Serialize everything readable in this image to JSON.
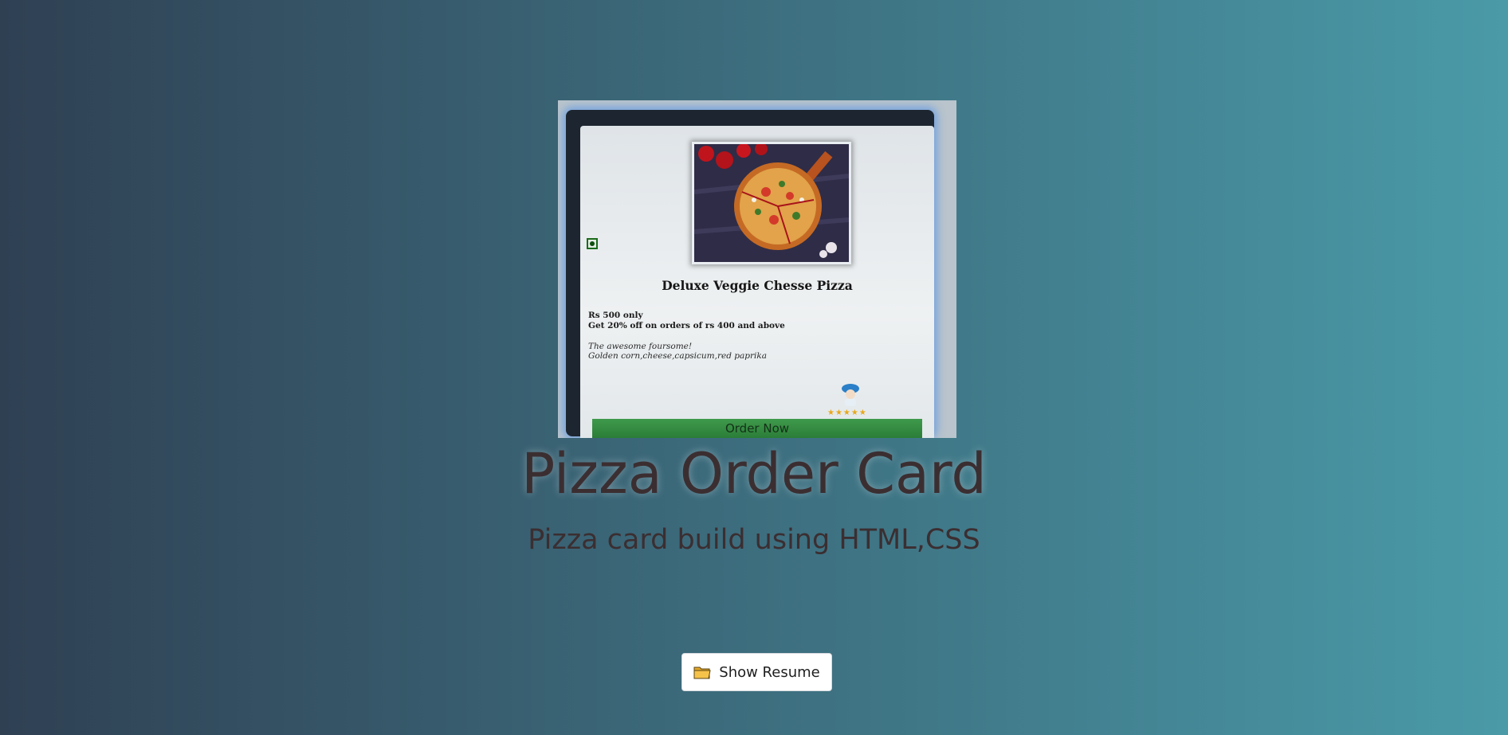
{
  "hero": {
    "card": {
      "title": "Deluxe Veggie Chesse Pizza",
      "price": "Rs 500 only",
      "offer": "Get 20% off on orders of rs 400 and above",
      "tagline": "The awesome foursome!",
      "toppings": "Golden corn,cheese,capsicum,red paprika",
      "rating_stars": "★★★★★",
      "order_button_label": "Order Now",
      "icons": [
        "veg-mark-icon",
        "chef-icon",
        "star-icon"
      ]
    }
  },
  "page": {
    "title": "Pizza Order Card",
    "subtitle": "Pizza card build using HTML,CSS"
  },
  "actions": {
    "show_resume_label": "Show Resume",
    "show_resume_icon": "folder-icon"
  },
  "colors": {
    "background_start": "#2f4053",
    "background_end": "#4a9aa8",
    "title_text": "#3b2e31",
    "order_button": "#2a7c36",
    "resume_button_bg": "#ffffff"
  }
}
